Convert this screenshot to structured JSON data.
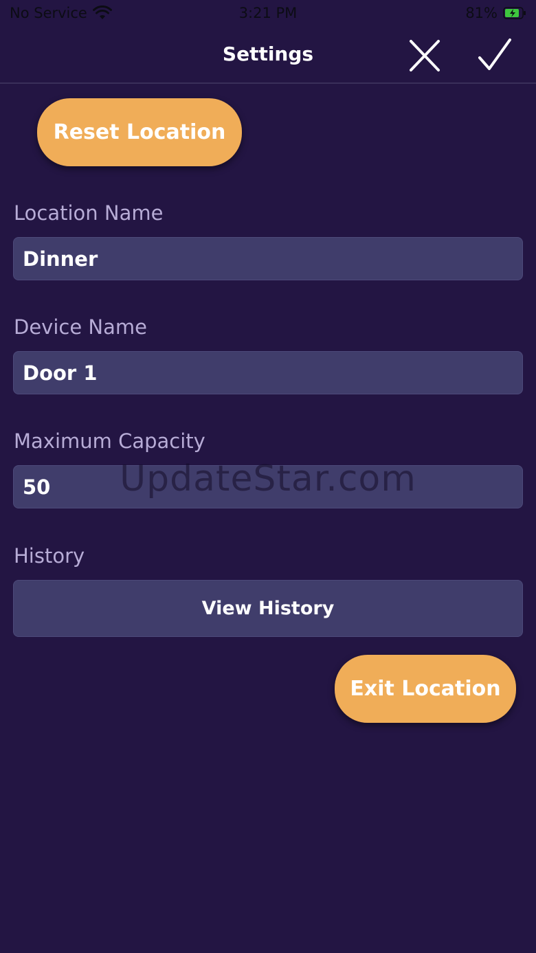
{
  "status_bar": {
    "carrier": "No Service",
    "time": "3:21 PM",
    "battery_percent": "81%",
    "icons": [
      "wifi-icon",
      "battery-charging-icon"
    ]
  },
  "nav": {
    "title": "Settings",
    "close_icon": "close-icon",
    "confirm_icon": "checkmark-icon"
  },
  "buttons": {
    "reset_location": "Reset Location",
    "view_history": "View History",
    "exit_location": "Exit Location"
  },
  "fields": {
    "location_name": {
      "label": "Location Name",
      "value": "Dinner"
    },
    "device_name": {
      "label": "Device Name",
      "value": "Door 1"
    },
    "maximum_capacity": {
      "label": "Maximum Capacity",
      "value": "50"
    },
    "history": {
      "label": "History"
    }
  },
  "watermark": "UpdateStar.com",
  "colors": {
    "background": "#231543",
    "accent": "#f0ad58",
    "input_background": "#403d6b",
    "label": "#b7acd6"
  }
}
